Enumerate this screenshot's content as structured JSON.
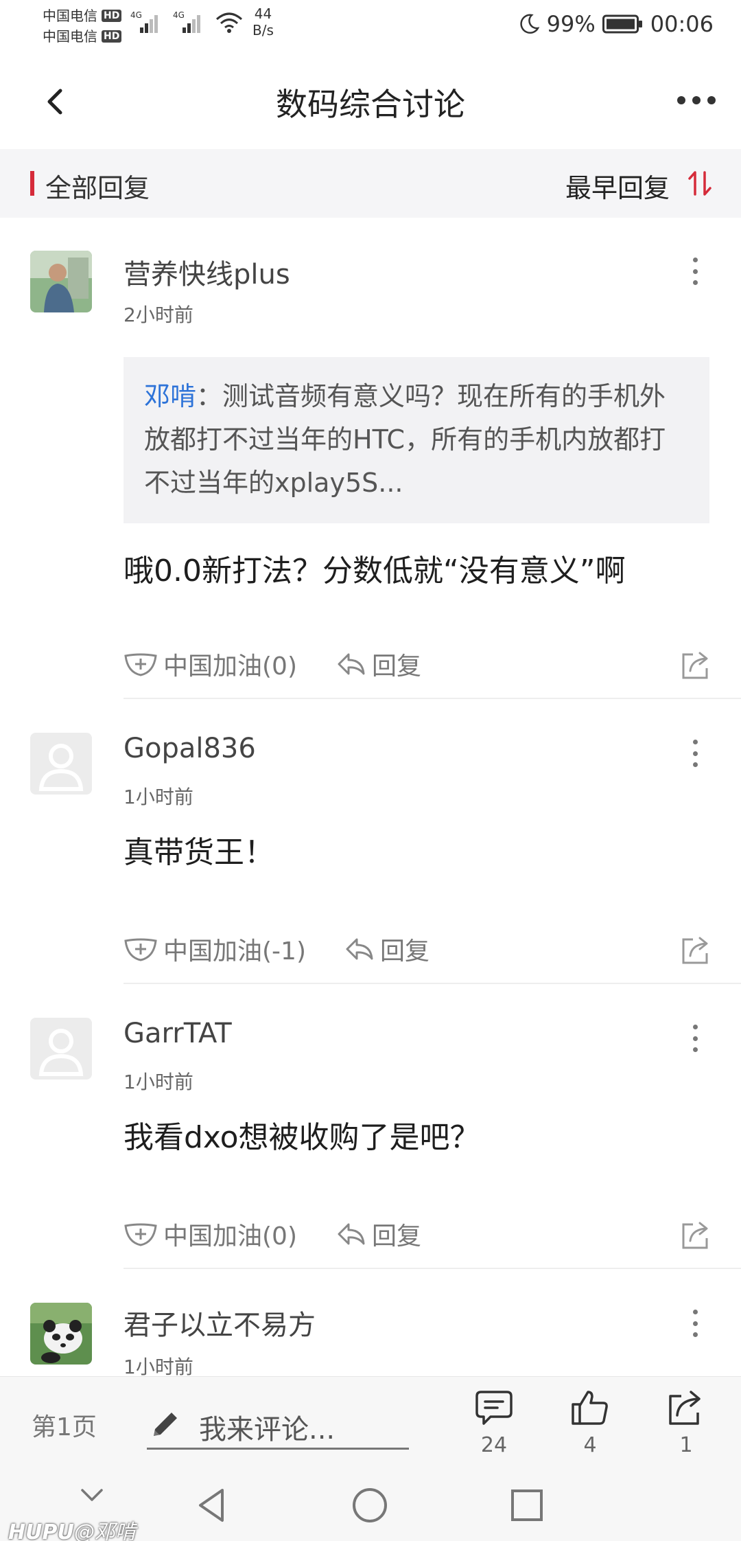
{
  "status_bar": {
    "carrier_1": "中国电信",
    "carrier_2": "中国电信",
    "hd_label": "HD",
    "network_type": "4G",
    "net_speed_value": "44",
    "net_speed_unit": "B/s",
    "battery": "99%",
    "time": "00:06"
  },
  "header": {
    "title": "数码综合讨论"
  },
  "filter_bar": {
    "all_replies": "全部回复",
    "sort_label": "最早回复",
    "accent_color": "#d52b3a"
  },
  "comments": [
    {
      "username": "营养快线plus",
      "time": "2小时前",
      "avatar": "photo-avatar",
      "quote": {
        "author": "邓啃",
        "text": "：测试音频有意义吗？现在所有的手机外放都打不过当年的HTC，所有的手机内放都打不过当年的xplay5S..."
      },
      "body": "哦0.0新打法？分数低就“没有意义”啊",
      "cheer_label": "中国加油(0)",
      "reply_label": "回复"
    },
    {
      "username": "Gopal836",
      "time": "1小时前",
      "avatar": "default-avatar",
      "body": "真带货王！",
      "cheer_label": "中国加油(-1)",
      "reply_label": "回复"
    },
    {
      "username": "GarrTAT",
      "time": "1小时前",
      "avatar": "default-avatar",
      "body": "我看dxo想被收购了是吧？",
      "cheer_label": "中国加油(0)",
      "reply_label": "回复"
    },
    {
      "username": "君子以立不易方",
      "time": "1小时前",
      "avatar": "panda-avatar"
    }
  ],
  "bottom_bar": {
    "page": "第1页",
    "comment_placeholder": "我来评论...",
    "comments_count": "24",
    "likes_count": "4",
    "shares_count": "1"
  },
  "watermark": {
    "brand": "HUPU",
    "user": "@邓啃"
  }
}
